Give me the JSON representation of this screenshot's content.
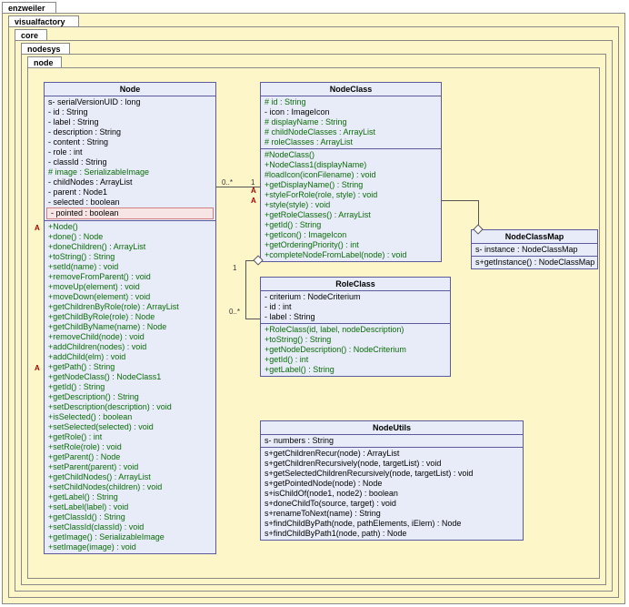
{
  "packages": [
    "enzweiler",
    "visualfactory",
    "core",
    "nodesys",
    "node"
  ],
  "classes": {
    "Node": {
      "title": "Node",
      "attrs": [
        "s- serialVersionUID : long",
        "- id : String",
        "- label : String",
        "- description : String",
        "- content : String",
        "- role : int",
        "- classId : String",
        "# image : SerializableImage",
        "- childNodes : ArrayList",
        "- parent : Node1",
        "- selected : boolean",
        "- pointed : boolean"
      ],
      "ops": [
        "+Node()",
        "+done() : Node",
        "+doneChildren() : ArrayList",
        "+toString() : String",
        "+setId(name) : void",
        "+removeFromParent() : void",
        "+moveUp(element) : void",
        "+moveDown(element) : void",
        "+getChildrenByRole(role) : ArrayList",
        "+getChildByRole(role) : Node",
        "+getChildByName(name) : Node",
        "+removeChild(node) : void",
        "+addChildren(nodes) : void",
        "+addChild(elm) : void",
        "+getPath() : String",
        "+getNodeClass() : NodeClass1",
        "+getId() : String",
        "+getDescription() : String",
        "+setDescription(description) : void",
        "+isSelected() : boolean",
        "+setSelected(selected) : void",
        "+getRole() : int",
        "+setRole(role) : void",
        "+getParent() : Node",
        "+setParent(parent) : void",
        "+getChildNodes() : ArrayList",
        "+setChildNodes(children) : void",
        "+getLabel() : String",
        "+setLabel(label) : void",
        "+getClassId() : String",
        "+setClassId(classId) : void",
        "+getImage() : SerializableImage",
        "+setImage(image) : void"
      ],
      "highlight_attr_index": 11,
      "abstract_op_indices": [
        1,
        15
      ]
    },
    "NodeClass": {
      "title": "NodeClass",
      "attrs": [
        "# id : String",
        "- icon : ImageIcon",
        "# displayName : String",
        "# childNodeClasses : ArrayList",
        "# roleClasses : ArrayList"
      ],
      "ops": [
        "#NodeClass()",
        "+NodeClass1(displayName)",
        "#loadIcon(iconFilename) : void",
        "+getDisplayName() : String",
        "+styleForRole(role, style) : void",
        "+style(style) : void",
        "+getRoleClasses() : ArrayList",
        "+getId() : String",
        "+getIcon() : ImageIcon",
        "+getOrderingPriority() : int",
        "+completeNodeFromLabel(node) : void"
      ],
      "abstract_op_indices": [
        4,
        5
      ]
    },
    "NodeClassMap": {
      "title": "NodeClassMap",
      "attrs": [
        "s- instance : NodeClassMap"
      ],
      "ops": [
        "s+getInstance() : NodeClassMap"
      ]
    },
    "RoleClass": {
      "title": "RoleClass",
      "attrs": [
        "- criterium : NodeCriterium",
        "- id : int",
        "- label : String"
      ],
      "ops": [
        "+RoleClass(id, label, nodeDescription)",
        "+toString() : String",
        "+getNodeDescription() : NodeCriterium",
        "+getId() : int",
        "+getLabel() : String"
      ]
    },
    "NodeUtils": {
      "title": "NodeUtils",
      "attrs": [
        "s- numbers : String"
      ],
      "ops": [
        "s+getChildrenRecur(node) : ArrayList",
        "s+getChildrenRecursively(node, targetList) : void",
        "s+getSelectedChildrenRecursively(node, targetList) : void",
        "s+getPointedNode(node) : Node",
        "s+isChildOf(node1, node2) : boolean",
        "s+doneChildTo(source, target) : void",
        "s+renameToNext(name) : String",
        "s+findChildByPath(node, pathElements, iElem) : Node",
        "s+findChildByPath1(node, path) : Node"
      ]
    }
  },
  "multiplicities": {
    "node_nodeclass_left": "0..*",
    "node_nodeclass_right": "1",
    "nodeclass_roleclass_top": "1",
    "nodeclass_roleclass_bottom": "0..*",
    "nodeclass_map": ""
  },
  "markers": {
    "A": "A"
  }
}
